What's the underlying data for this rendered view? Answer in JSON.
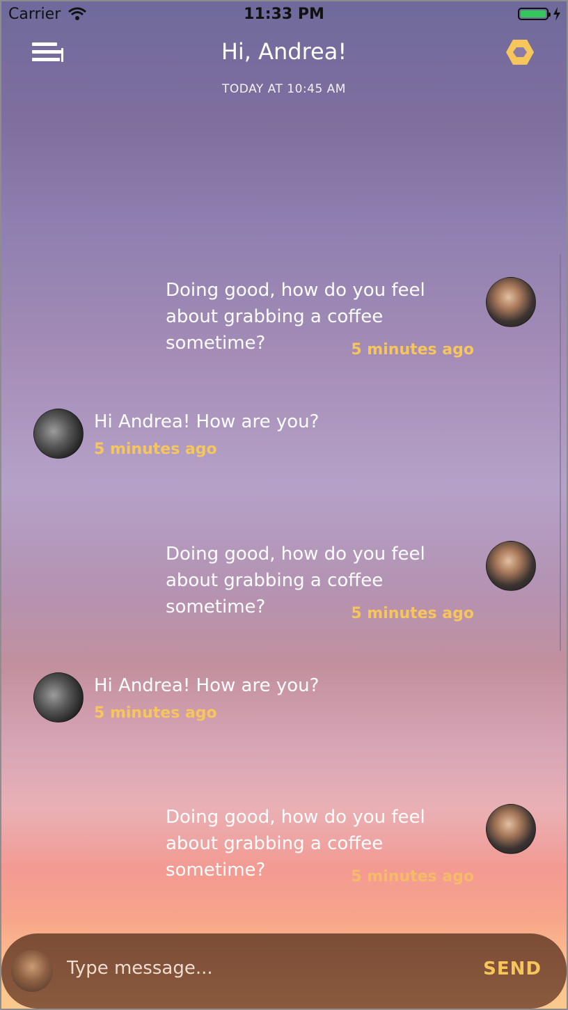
{
  "status": {
    "carrier": "Carrier",
    "time": "11:33 PM"
  },
  "header": {
    "title": "Hi, Andrea!",
    "subtitle": "TODAY AT 10:45 AM"
  },
  "messages": [
    {
      "side": "right",
      "text": "Doing good, how do you feel about grabbing a coffee sometime?",
      "time": "5 minutes ago"
    },
    {
      "side": "left",
      "text": "Hi Andrea! How are you?",
      "time": "5 minutes ago"
    },
    {
      "side": "right",
      "text": "Doing good, how do you feel about grabbing a coffee sometime?",
      "time": "5 minutes ago"
    },
    {
      "side": "left",
      "text": "Hi Andrea! How are you?",
      "time": "5 minutes ago"
    },
    {
      "side": "right",
      "text": "Doing good, how do you feel about grabbing a coffee sometime?",
      "time": "5 minutes ago"
    }
  ],
  "composer": {
    "placeholder": "Type message...",
    "send_label": "SEND"
  },
  "colors": {
    "accent": "#f6c65c",
    "battery": "#34c759"
  }
}
